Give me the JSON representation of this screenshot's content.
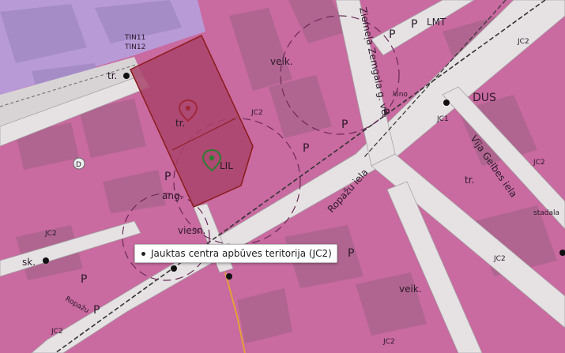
{
  "colors": {
    "mixed_center_zone": "#c96aa0",
    "industrial_zone": "#b79ad6",
    "road": "#e6e2e4",
    "building": "#b06590",
    "selected_parcel": "#a8436a",
    "parcel_border": "#8b1c1c",
    "pin_red": "#a0283c",
    "pin_green": "#2e7d32"
  },
  "labels": {
    "street_zemgala": "Ziemeļa Zemgala g. ve",
    "street_ropazu": "Ropažu iela",
    "street_gelbes": "Vīja Gelbes iela",
    "street_misc": "Ropažu",
    "zone_jc2": "JC2",
    "zone_jc1": "JC1",
    "tn11": "TIN11",
    "tn12": "TIN12",
    "veik": "veik.",
    "p": "P",
    "tr": "tr.",
    "dus": "DUS",
    "lmt": "LMT",
    "ang": "ang.",
    "viesn": "viesn.",
    "sk": "sk.",
    "d": "D",
    "lil": "LIL",
    "stadala": "stadala",
    "kiino": "kino"
  },
  "tooltip": {
    "text": "Jauktas centra apbūves teritorija (JC2)"
  },
  "icons": [
    "location-pin-red-icon",
    "location-pin-green-icon",
    "bus-stop-icon"
  ]
}
